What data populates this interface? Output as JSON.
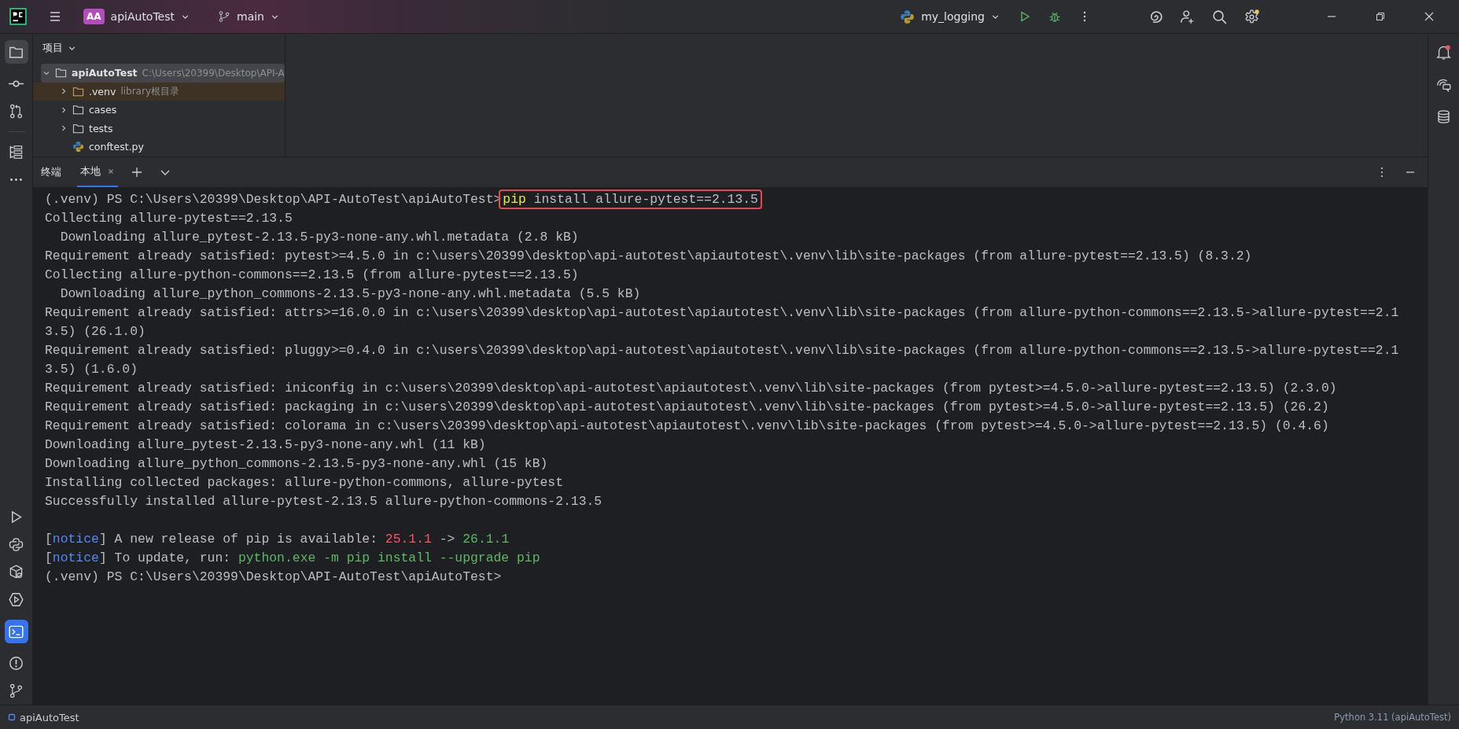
{
  "title_bar": {
    "project_badge": "AA",
    "project": "apiAutoTest",
    "branch": "main",
    "run_config": "my_logging"
  },
  "project_panel": {
    "title": "项目",
    "tree": [
      {
        "label": "apiAutoTest",
        "hint": "C:\\Users\\20399\\Desktop\\API-A",
        "kind": "folder",
        "expanded": true,
        "selected": true,
        "children": [
          {
            "label": ".venv",
            "hint": "library根目录",
            "kind": "library",
            "expanded": false,
            "selected": false
          },
          {
            "label": "cases",
            "kind": "folder",
            "expanded": false,
            "selected": false
          },
          {
            "label": "tests",
            "kind": "folder",
            "expanded": false,
            "selected": false
          },
          {
            "label": "conftest.py",
            "kind": "python-file",
            "selected": false
          }
        ]
      }
    ]
  },
  "terminal": {
    "title": "终端",
    "tabs": [
      {
        "label": "本地",
        "selected": true
      }
    ],
    "lines": [
      {
        "kind": "prompt",
        "segments": [
          {
            "text": "(.venv) PS C:\\Users\\20399\\Desktop\\API-AutoTest\\apiAutoTest>",
            "kind": "plain"
          }
        ],
        "marked": [
          {
            "text": "pip",
            "kind": "keyword"
          },
          {
            "text": " install allure-pytest==2.13.5",
            "kind": "plain"
          }
        ]
      },
      {
        "kind": "output",
        "segments": [
          {
            "text": "Collecting allure-pytest==2.13.5",
            "kind": "plain"
          }
        ]
      },
      {
        "kind": "output",
        "segments": [
          {
            "text": "  Downloading allure_pytest-2.13.5-py3-none-any.whl.metadata (2.8 kB)",
            "kind": "plain"
          }
        ]
      },
      {
        "kind": "output",
        "segments": [
          {
            "text": "Requirement already satisfied: pytest>=4.5.0 in c:\\users\\20399\\desktop\\api-autotest\\apiautotest\\.venv\\lib\\site-packages (from allure-pytest==2.13.5) (8.3.2)",
            "kind": "plain"
          }
        ]
      },
      {
        "kind": "output",
        "segments": [
          {
            "text": "Collecting allure-python-commons==2.13.5 (from allure-pytest==2.13.5)",
            "kind": "plain"
          }
        ]
      },
      {
        "kind": "output",
        "segments": [
          {
            "text": "  Downloading allure_python_commons-2.13.5-py3-none-any.whl.metadata (5.5 kB)",
            "kind": "plain"
          }
        ]
      },
      {
        "kind": "output",
        "segments": [
          {
            "text": "Requirement already satisfied: attrs>=16.0.0 in c:\\users\\20399\\desktop\\api-autotest\\apiautotest\\.venv\\lib\\site-packages (from allure-python-commons==2.13.5->allure-pytest==2.1",
            "kind": "plain"
          }
        ]
      },
      {
        "kind": "output",
        "segments": [
          {
            "text": "3.5) (26.1.0)",
            "kind": "plain"
          }
        ]
      },
      {
        "kind": "output",
        "segments": [
          {
            "text": "Requirement already satisfied: pluggy>=0.4.0 in c:\\users\\20399\\desktop\\api-autotest\\apiautotest\\.venv\\lib\\site-packages (from allure-python-commons==2.13.5->allure-pytest==2.1",
            "kind": "plain"
          }
        ]
      },
      {
        "kind": "output",
        "segments": [
          {
            "text": "3.5) (1.6.0)",
            "kind": "plain"
          }
        ]
      },
      {
        "kind": "output",
        "segments": [
          {
            "text": "Requirement already satisfied: iniconfig in c:\\users\\20399\\desktop\\api-autotest\\apiautotest\\.venv\\lib\\site-packages (from pytest>=4.5.0->allure-pytest==2.13.5) (2.3.0)",
            "kind": "plain"
          }
        ]
      },
      {
        "kind": "output",
        "segments": [
          {
            "text": "Requirement already satisfied: packaging in c:\\users\\20399\\desktop\\api-autotest\\apiautotest\\.venv\\lib\\site-packages (from pytest>=4.5.0->allure-pytest==2.13.5) (26.2)",
            "kind": "plain"
          }
        ]
      },
      {
        "kind": "output",
        "segments": [
          {
            "text": "Requirement already satisfied: colorama in c:\\users\\20399\\desktop\\api-autotest\\apiautotest\\.venv\\lib\\site-packages (from pytest>=4.5.0->allure-pytest==2.13.5) (0.4.6)",
            "kind": "plain"
          }
        ]
      },
      {
        "kind": "output",
        "segments": [
          {
            "text": "Downloading allure_pytest-2.13.5-py3-none-any.whl (11 kB)",
            "kind": "plain"
          }
        ]
      },
      {
        "kind": "output",
        "segments": [
          {
            "text": "Downloading allure_python_commons-2.13.5-py3-none-any.whl (15 kB)",
            "kind": "plain"
          }
        ]
      },
      {
        "kind": "output",
        "segments": [
          {
            "text": "Installing collected packages: allure-python-commons, allure-pytest",
            "kind": "plain"
          }
        ]
      },
      {
        "kind": "output",
        "segments": [
          {
            "text": "Successfully installed allure-pytest-2.13.5 allure-python-commons-2.13.5",
            "kind": "plain"
          }
        ]
      },
      {
        "kind": "blank"
      },
      {
        "kind": "output",
        "segments": [
          {
            "text": "[",
            "kind": "plain"
          },
          {
            "text": "notice",
            "kind": "notice"
          },
          {
            "text": "] A new release of pip is available: ",
            "kind": "plain"
          },
          {
            "text": "25.1.1",
            "kind": "old"
          },
          {
            "text": " -> ",
            "kind": "plain"
          },
          {
            "text": "26.1.1",
            "kind": "new"
          }
        ]
      },
      {
        "kind": "output",
        "segments": [
          {
            "text": "[",
            "kind": "plain"
          },
          {
            "text": "notice",
            "kind": "notice"
          },
          {
            "text": "] To update, run: ",
            "kind": "plain"
          },
          {
            "text": "python.exe -m pip install --upgrade pip",
            "kind": "new"
          }
        ]
      },
      {
        "kind": "output",
        "segments": [
          {
            "text": "(.venv) PS C:\\Users\\20399\\Desktop\\API-AutoTest\\apiAutoTest>",
            "kind": "plain"
          }
        ]
      }
    ]
  },
  "status_bar": {
    "project": "apiAutoTest",
    "interpreter": "Python 3.11 (apiAutoTest)"
  }
}
